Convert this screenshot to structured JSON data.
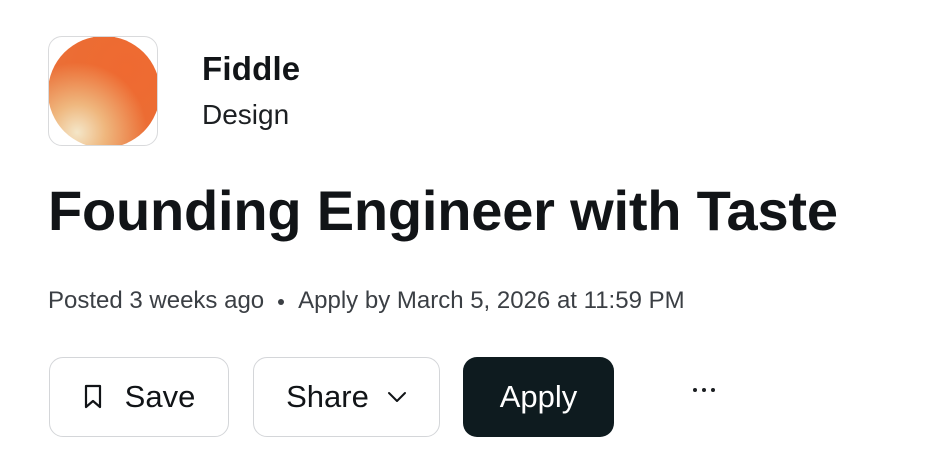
{
  "company": {
    "name": "Fiddle",
    "category": "Design",
    "logo_icon": "orange-gradient-circle-logo"
  },
  "job": {
    "title": "Founding Engineer with Taste",
    "posted": "Posted 3 weeks ago",
    "deadline": "Apply by March 5, 2026 at 11:59 PM"
  },
  "actions": {
    "save_label": "Save",
    "save_icon": "bookmark-icon",
    "share_label": "Share",
    "share_icon": "chevron-down-icon",
    "apply_label": "Apply",
    "more_icon": "more-horizontal-icon"
  },
  "colors": {
    "primary_button": "#0e1b1f",
    "logo_orange": "#ec6c33",
    "text": "#111417"
  }
}
